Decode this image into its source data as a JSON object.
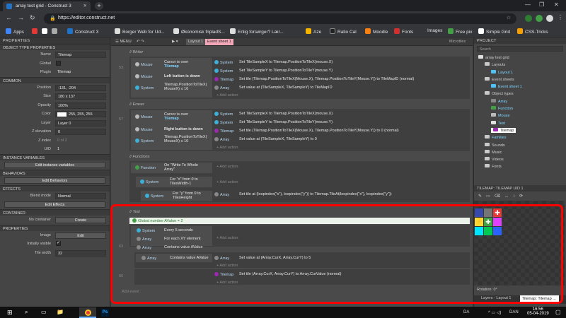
{
  "browser": {
    "tab_title": "array test grid - Construct 3",
    "url": "https://editor.construct.net",
    "bookmarks": [
      "Apps",
      "Construct 3",
      "Borger Web for Ud...",
      "Økonomisk fripladS...",
      "Enlig forsørger? Lær...",
      "Aze",
      "Ratio Cal",
      "Moodle",
      "Fonts",
      "Images",
      "Free pix",
      "Simple Grid",
      "CSS-Tricks"
    ]
  },
  "left_panel": {
    "title": "PROPERTIES",
    "section_object_type": "OBJECT TYPE PROPERTIES",
    "name_label": "Name",
    "name_value": "Tilemap",
    "global_label": "Global",
    "plugin_label": "Plugin",
    "plugin_value": "Tilemap",
    "section_common": "COMMON",
    "position_label": "Position",
    "position_value": "-131, -204",
    "size_label": "Size",
    "size_value": "180 x 137",
    "opacity_label": "Opacity",
    "opacity_value": "100%",
    "color_label": "Color",
    "color_value": "255, 255, 255",
    "layer_label": "Layer",
    "layer_value": "Layer 0",
    "zelev_label": "Z elevation",
    "zelev_value": "0",
    "zindex_label": "Z index",
    "zindex_value": "0 of 2",
    "uid_label": "UID",
    "uid_value": "1",
    "section_inst": "INSTANCE VARIABLES",
    "edit_inst": "Edit instance variables",
    "section_beh": "BEHAVIORS",
    "edit_beh": "Edit Behaviors",
    "section_fx": "EFFECTS",
    "blend_label": "Blend mode",
    "blend_value": "Normal",
    "edit_fx": "Edit Effects",
    "section_container": "CONTAINER",
    "container_label": "No container",
    "create": "Create",
    "section_props": "PROPERTIES",
    "image_label": "Image",
    "image_btn": "Edit",
    "visible_label": "Initially visible",
    "tilewidth_label": "Tile width",
    "tilewidth_value": "32"
  },
  "center": {
    "menu": "MENU",
    "tab_layout": "Layout 1",
    "tab_events": "Event sheet 1",
    "microtiles": "Microtiles",
    "group_writer": "Writer",
    "group_eraser": "Eraser",
    "group_functions": "Functions",
    "group_test": "Test",
    "ev1_num": "53",
    "ev2_num": "57",
    "ev3_num": "62",
    "ev4_num": "63",
    "ev5_num": "65",
    "ev6_num": "66",
    "mouse": "Mouse",
    "system": "System",
    "array": "Array",
    "tilemap": "Tilemap",
    "function_obj": "Function",
    "cursor_over": "Cursor is over",
    "cursor_obj": "Tilemap",
    "left_down": "Left button is down",
    "right_down": "Right button is down",
    "cmp_expr": "Tilemap.PositionToTileX( MouseX) ≤ 16",
    "set_sample_x": "Set TileSampleX to Tilemap.PositionToTileX(mouse.X)",
    "set_sample_y": "Set TileSampleY to Tilemap.PositionToTileY(mouse.Y)",
    "set_tile_writer": "Set tile (Tilemap.PositionToTileX(Mouse.X), Tilemap.PositionToTileY(Mouse.Y)) to TileMapID (normal)",
    "set_value_writer": "Set value at (TileSampleX, TileSampleY) to TileMapID",
    "set_tile_eraser": "Set tile (Tilemap.PositionToTileX(Mouse.X), Tilemap.PositionToTileY(Mouse.Y)) to 0 (normal)",
    "set_value_eraser": "Set value at (TileSampleX, TileSampleY) to 0",
    "add_action": "+ Add action",
    "on_func": "On \"Write To Whole Array\"",
    "for_x": "For \"x\" from 0 to TilesWidth-1",
    "for_y": "For \"y\" from 0 to TilesHeight",
    "set_tile_loop": "Set tile at (loopindex(\"x\"), loopindex(\"y\")) to Tilemap.TileAt(loopindex(\"x\"), loopindex(\"y\"))",
    "global_var": "Global number AValue = 2",
    "every": "Every 5 seconds",
    "for_each": "For each XY element",
    "contains": "Contains value AValue",
    "set_value_test": "Set value at (Array.CurX, Array.CurY) to 5",
    "set_tile_test": "Set tile (Array.CurX, Array.CurY) to Array.CurValue (normal)",
    "add_event": "Add event"
  },
  "right_panel": {
    "title": "PROJECT",
    "search": "Search",
    "tree": [
      "array test grid",
      "Layouts",
      "Layout 1",
      "Event sheets",
      "Event sheet 1",
      "Object types",
      "Array",
      "Function",
      "Mouse",
      "Text",
      "Tilemap",
      "Families",
      "Sounds",
      "Music",
      "Videos",
      "Fonts"
    ],
    "tilemap_title": "TILEMAP: TILEMAP UID 1",
    "rotation": "Rotation: 0°",
    "bottom_tab1": "Layers - Layout 1",
    "bottom_tab2": "Tilemap: Tilemap ..."
  },
  "taskbar": {
    "time": "16:56",
    "date": "05-04-2019",
    "lang": "DAN",
    "lang2": "DA"
  }
}
